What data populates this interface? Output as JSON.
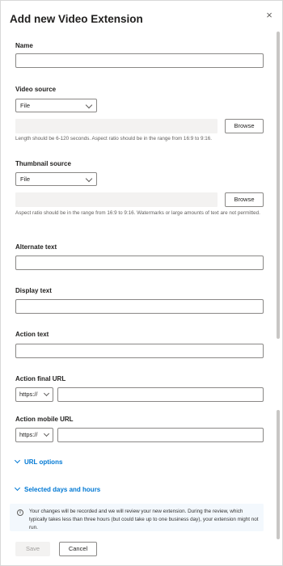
{
  "title": "Add new Video Extension",
  "close_icon": "×",
  "fields": {
    "name_label": "Name",
    "video_source_label": "Video source",
    "video_source_value": "File",
    "video_browse": "Browse",
    "video_hint": "Length should be 6-120 seconds. Aspect ratio should be in the range from 16:9 to 9:16.",
    "thumb_source_label": "Thumbnail source",
    "thumb_source_value": "File",
    "thumb_browse": "Browse",
    "thumb_hint": "Aspect ratio should be in the range from 16:9 to 9:16. Watermarks or large amounts of text are not permitted.",
    "alt_text_label": "Alternate text",
    "display_text_label": "Display text",
    "action_text_label": "Action text",
    "final_url_label": "Action final URL",
    "final_url_proto": "https://",
    "mobile_url_label": "Action mobile URL",
    "mobile_url_proto": "https://"
  },
  "expanders": {
    "url_options": "URL options",
    "selected_days": "Selected days and hours"
  },
  "info": {
    "icon": "i",
    "text": "Your changes will be recorded and we will review your new extension. During the review, which typically takes less than three hours (but could take up to one business day), your extension might not run."
  },
  "buttons": {
    "save": "Save",
    "cancel": "Cancel"
  }
}
